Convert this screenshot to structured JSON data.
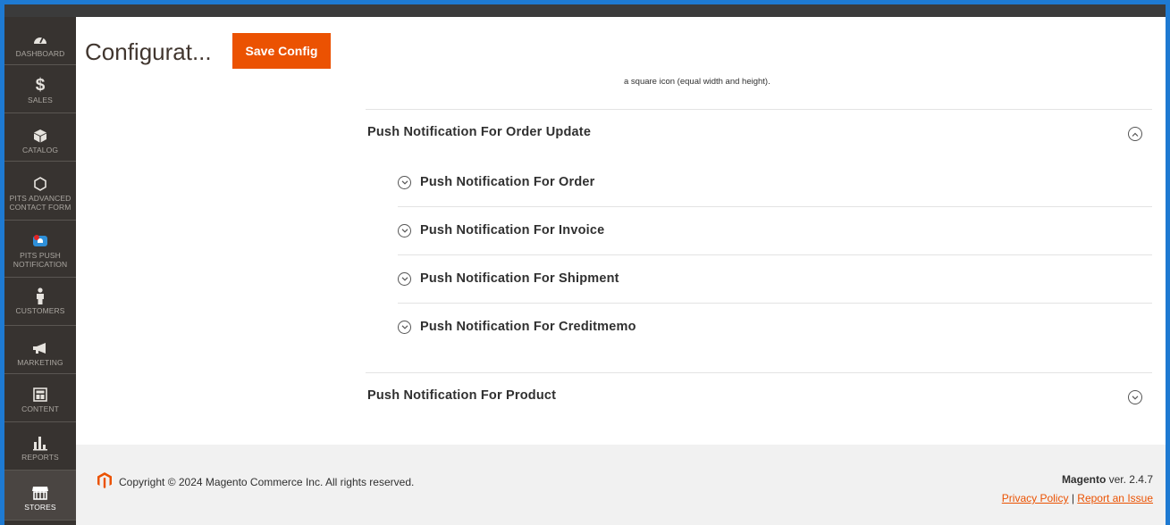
{
  "sidebar": {
    "items": [
      {
        "label": "Dashboard",
        "icon": "gauge-icon"
      },
      {
        "label": "Sales",
        "icon": "dollar-icon"
      },
      {
        "label": "Catalog",
        "icon": "box-icon"
      },
      {
        "label": "Pits Advanced Contact Form",
        "icon": "hexagon-icon"
      },
      {
        "label": "Pits Push Notification",
        "icon": "notification-icon"
      },
      {
        "label": "Customers",
        "icon": "person-icon"
      },
      {
        "label": "Marketing",
        "icon": "megaphone-icon"
      },
      {
        "label": "Content",
        "icon": "layout-icon"
      },
      {
        "label": "Reports",
        "icon": "bar-chart-icon"
      },
      {
        "label": "Stores",
        "icon": "store-icon"
      }
    ],
    "active": "Stores"
  },
  "header": {
    "title": "Configurat...",
    "save_label": "Save Config"
  },
  "content": {
    "note": "a square icon (equal width and height).",
    "sections": [
      {
        "title": "Push Notification For Order Update",
        "expanded": true,
        "items": [
          "Push Notification For Order",
          "Push Notification For Invoice",
          "Push Notification For Shipment",
          "Push Notification For Creditmemo"
        ]
      },
      {
        "title": "Push Notification For Product",
        "expanded": false,
        "items": []
      }
    ]
  },
  "footer": {
    "copyright": "Copyright © 2024 Magento Commerce Inc. All rights reserved.",
    "brand": "Magento",
    "version": "ver. 2.4.7",
    "privacy_label": "Privacy Policy",
    "separator": "|",
    "report_label": "Report an Issue"
  },
  "colors": {
    "accent": "#eb5202",
    "sidebar_bg": "#373330",
    "frame_border": "#1e7ad2"
  }
}
